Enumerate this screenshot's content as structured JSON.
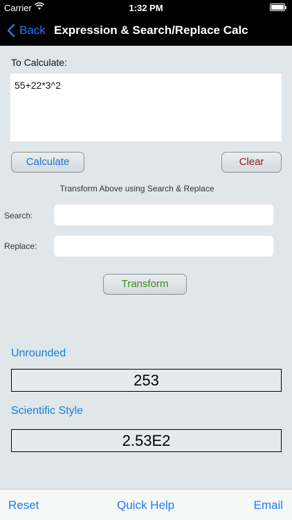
{
  "status_bar": {
    "carrier": "Carrier",
    "time": "1:32 PM",
    "battery_level": 1.0
  },
  "nav": {
    "back_label": "Back",
    "title": "Expression & Search/Replace Calc"
  },
  "calculate": {
    "label": "To Calculate:",
    "expression": "55+22*3^2"
  },
  "buttons": {
    "calculate": "Calculate",
    "clear": "Clear",
    "transform": "Transform"
  },
  "transform_section": {
    "note": "Transform Above using Search & Replace",
    "search_label": "Search:",
    "search_value": "",
    "replace_label": "Replace:",
    "replace_value": ""
  },
  "results": {
    "unrounded_label": "Unrounded",
    "unrounded_value": "253",
    "scientific_label": "Scientific Style",
    "scientific_value": "2.53E2"
  },
  "tab_bar": {
    "reset": "Reset",
    "quick_help": "Quick Help",
    "email": "Email"
  },
  "colors": {
    "accent": "#1a7bff",
    "calculate_text": "#1a6fd6",
    "clear_text": "#8c1b13",
    "transform_text": "#3a8a1a",
    "background": "#dfe7ea"
  }
}
